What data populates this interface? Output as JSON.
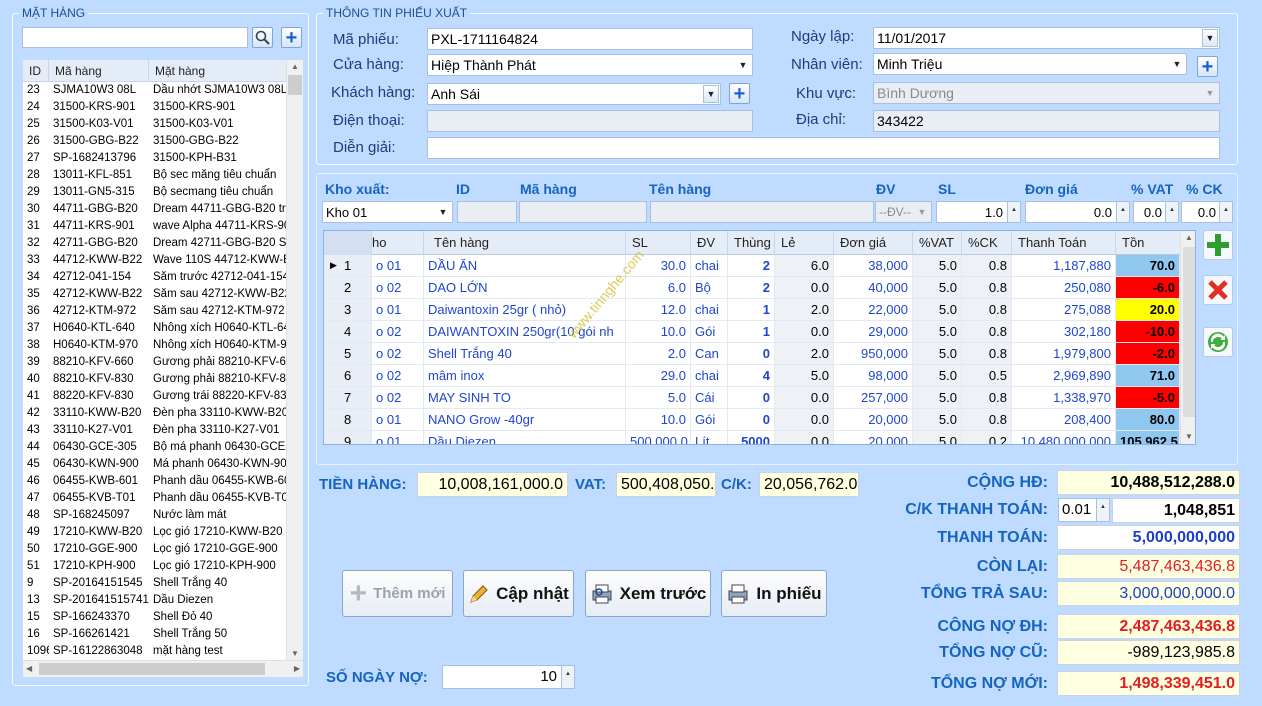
{
  "left": {
    "legend": "MẶT HÀNG",
    "search_value": "",
    "headers": [
      "ID",
      "Mã hàng",
      "Mặt hàng"
    ],
    "rows": [
      [
        "23",
        "SJMA10W3 08L",
        "Dầu nhớt SJMA10W3 08L"
      ],
      [
        "24",
        "31500-KRS-901",
        "31500-KRS-901"
      ],
      [
        "25",
        "31500-K03-V01",
        "31500-K03-V01"
      ],
      [
        "26",
        "31500-GBG-B22",
        "31500-GBG-B22"
      ],
      [
        "27",
        "SP-1682413796",
        "31500-KPH-B31"
      ],
      [
        "28",
        "13011-KFL-851",
        "Bộ sec măng tiêu chuẩn"
      ],
      [
        "29",
        "13011-GN5-315",
        "Bộ secmang tiêu chuẩn"
      ],
      [
        "30",
        "44711-GBG-B20",
        "Dream 44711-GBG-B20 tru"
      ],
      [
        "31",
        "44711-KRS-901",
        "wave Alpha 44711-KRS-90"
      ],
      [
        "32",
        "42711-GBG-B20",
        "Dream 42711-GBG-B20 Sa"
      ],
      [
        "33",
        "44712-KWW-B22",
        "Wave 110S 44712-KWW-B"
      ],
      [
        "34",
        "42712-041-154",
        "Săm trước 42712-041-154"
      ],
      [
        "35",
        "42712-KWW-B22",
        "Săm sau 42712-KWW-B22"
      ],
      [
        "36",
        "42712-KTM-972",
        "Săm sau 42712-KTM-972"
      ],
      [
        "37",
        "H0640-KTL-640",
        "Nhông xích H0640-KTL-64"
      ],
      [
        "38",
        "H0640-KTM-970",
        "Nhông xích H0640-KTM-97"
      ],
      [
        "39",
        "88210-KFV-660",
        "Gương phải 88210-KFV-66"
      ],
      [
        "40",
        "88210-KFV-830",
        "Gương phải 88210-KFV-83"
      ],
      [
        "41",
        "88220-KFV-830",
        "Gương trái 88220-KFV-830"
      ],
      [
        "42",
        "33110-KWW-B20",
        "Đèn pha 33110-KWW-B20"
      ],
      [
        "43",
        "33110-K27-V01",
        "Đèn pha 33110-K27-V01"
      ],
      [
        "44",
        "06430-GCE-305",
        "Bộ má phanh 06430-GCE-3"
      ],
      [
        "45",
        "06430-KWN-900",
        "Má phanh 06430-KWN-900"
      ],
      [
        "46",
        "06455-KWB-601",
        "Phanh dầu 06455-KWB-601"
      ],
      [
        "47",
        "06455-KVB-T01",
        "Phanh dầu 06455-KVB-T01"
      ],
      [
        "48",
        "SP-168245097",
        "Nước làm mát"
      ],
      [
        "49",
        "17210-KWW-B20",
        "Lọc gió 17210-KWW-B20"
      ],
      [
        "50",
        "17210-GGE-900",
        "Lọc gió 17210-GGE-900"
      ],
      [
        "51",
        "17210-KPH-900",
        "Lọc gió 17210-KPH-900"
      ],
      [
        "9",
        "SP-20164151545",
        "Shell Trắng 40"
      ],
      [
        "13",
        "SP-201641515741",
        "Dầu Diezen"
      ],
      [
        "15",
        "SP-166243370",
        "Shell Đỏ 40"
      ],
      [
        "16",
        "SP-166261421",
        "Shell Trắng 50"
      ],
      [
        "1096",
        "SP-16122863048",
        "mặt hàng test"
      ]
    ]
  },
  "info": {
    "legend": "THÔNG TIN PHIẾU XUẤT",
    "ma_phieu_label": "Mã phiếu:",
    "ma_phieu": "PXL-1711164824",
    "cua_hang_label": "Cửa hàng:",
    "cua_hang": "Hiệp Thành Phát",
    "khach_hang_label": "Khách hàng:",
    "khach_hang": "Anh Sái",
    "dien_thoai_label": "Điện thoại:",
    "dien_thoai": "",
    "dien_giai_label": "Diễn giải:",
    "dien_giai": "",
    "ngay_lap_label": "Ngày lập:",
    "ngay_lap": "11/01/2017",
    "nhan_vien_label": "Nhân viên:",
    "nhan_vien": "Minh Triệu",
    "khu_vuc_label": "Khu vực:",
    "khu_vuc": "Bình Dương",
    "dia_chi_label": "Địa chỉ:",
    "dia_chi": "343422"
  },
  "entry": {
    "kho_label": "Kho xuất:",
    "id_label": "ID",
    "ma_label": "Mã hàng",
    "ten_label": "Tên hàng",
    "dv_label": "ĐV",
    "sl_label": "SL",
    "dongia_label": "Đơn giá",
    "vat_label": "% VAT",
    "ck_label": "% CK",
    "kho": "Kho 01",
    "dv_placeholder": "--ĐV--",
    "sl": "1.0",
    "dongia": "0.0",
    "vat": "0.0",
    "ck": "0.0"
  },
  "grid": {
    "headers": [
      "ho",
      "Tên hàng",
      "SL",
      "ĐV",
      "Thùng",
      "Lẻ",
      "Đơn giá",
      "%VAT",
      "%CK",
      "Thanh Toán",
      "Tồn"
    ],
    "rows": [
      {
        "no": "1",
        "kho": "o 01",
        "ten": "DẦU ĂN",
        "sl": "30.0",
        "dv": "chai",
        "thung": "2",
        "le": "6.0",
        "dongia": "38,000",
        "vat": "5.0",
        "ck": "0.8",
        "tt": "1,187,880",
        "ton": "70.0",
        "tc": "#8fc7ef"
      },
      {
        "no": "2",
        "kho": "o 02",
        "ten": "DAO LỚN",
        "sl": "6.0",
        "dv": "Bộ",
        "thung": "2",
        "le": "0.0",
        "dongia": "40,000",
        "vat": "5.0",
        "ck": "0.8",
        "tt": "250,080",
        "ton": "-6.0",
        "tc": "#ff0000"
      },
      {
        "no": "3",
        "kho": "o 01",
        "ten": "Daiwantoxin 25gr ( nhỏ)",
        "sl": "12.0",
        "dv": "chai",
        "thung": "1",
        "le": "2.0",
        "dongia": "22,000",
        "vat": "5.0",
        "ck": "0.8",
        "tt": "275,088",
        "ton": "20.0",
        "tc": "#ffff00"
      },
      {
        "no": "4",
        "kho": "o 02",
        "ten": "DAIWANTOXIN 250gr(10 gói nh",
        "sl": "10.0",
        "dv": "Gói",
        "thung": "1",
        "le": "0.0",
        "dongia": "29,000",
        "vat": "5.0",
        "ck": "0.8",
        "tt": "302,180",
        "ton": "-10.0",
        "tc": "#ff0000"
      },
      {
        "no": "5",
        "kho": "o 02",
        "ten": "Shell Trắng 40",
        "sl": "2.0",
        "dv": "Can",
        "thung": "0",
        "le": "2.0",
        "dongia": "950,000",
        "vat": "5.0",
        "ck": "0.8",
        "tt": "1,979,800",
        "ton": "-2.0",
        "tc": "#ff0000"
      },
      {
        "no": "6",
        "kho": "o 02",
        "ten": "mâm inox",
        "sl": "29.0",
        "dv": "chai",
        "thung": "4",
        "le": "5.0",
        "dongia": "98,000",
        "vat": "5.0",
        "ck": "0.5",
        "tt": "2,969,890",
        "ton": "71.0",
        "tc": "#8fc7ef"
      },
      {
        "no": "7",
        "kho": "o 02",
        "ten": "MAY SINH TO",
        "sl": "5.0",
        "dv": "Cái",
        "thung": "0",
        "le": "0.0",
        "dongia": "257,000",
        "vat": "5.0",
        "ck": "0.8",
        "tt": "1,338,970",
        "ton": "-5.0",
        "tc": "#ff0000"
      },
      {
        "no": "8",
        "kho": "o 01",
        "ten": "NANO Grow -40gr",
        "sl": "10.0",
        "dv": "Gói",
        "thung": "0",
        "le": "0.0",
        "dongia": "20,000",
        "vat": "5.0",
        "ck": "0.8",
        "tt": "208,400",
        "ton": "80.0",
        "tc": "#8fc7ef"
      },
      {
        "no": "9",
        "kho": "o 01",
        "ten": "Dầu Diezen",
        "sl": "500,000.0",
        "dv": "Lít",
        "thung": "5000",
        "le": "0.0",
        "dongia": "20,000",
        "vat": "5.0",
        "ck": "0.2",
        "tt": "10,480,000,000",
        "ton": "105,962.5",
        "tc": "#8fc7ef"
      }
    ]
  },
  "watermark": "www.tinnghe.com",
  "totals": {
    "tien_hang_label": "TIỀN HÀNG:",
    "tien_hang": "10,008,161,000.0",
    "vat_label": "VAT:",
    "vat": "500,408,050.0",
    "ck_label": "C/K:",
    "ck": "20,056,762.0",
    "cong_hd_label": "CỘNG HĐ:",
    "cong_hd": "10,488,512,288.0",
    "ck_tt_label": "C/K THANH TOÁN:",
    "ck_tt_pct": "0.01",
    "ck_tt": "1,048,851",
    "thanh_toan_label": "THANH TOÁN:",
    "thanh_toan": "5,000,000,000",
    "con_lai_label": "CÒN LẠI:",
    "con_lai": "5,487,463,436.8",
    "tong_tra_sau_label": "TỔNG TRẢ SAU:",
    "tong_tra_sau": "3,000,000,000.0",
    "cong_no_dh_label": "CÔNG NỢ ĐH:",
    "cong_no_dh": "2,487,463,436.8",
    "tong_no_cu_label": "TỔNG NỢ CŨ:",
    "tong_no_cu": "-989,123,985.8",
    "tong_no_moi_label": "TỔNG NỢ MỚI:",
    "tong_no_moi": "1,498,339,451.0"
  },
  "buttons": {
    "them_moi": "Thêm mới",
    "cap_nhat": "Cập nhật",
    "xem_truoc": "Xem trước",
    "in_phieu": "In phiếu"
  },
  "so_ngay_no_label": "SỐ NGÀY NỢ:",
  "so_ngay_no": "10"
}
